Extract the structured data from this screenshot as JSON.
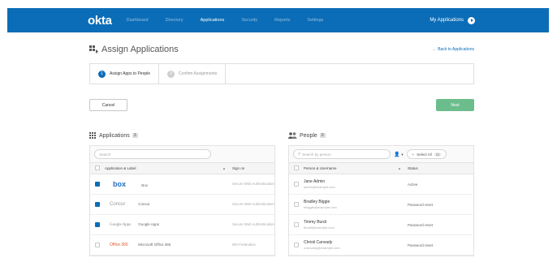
{
  "topbar": {
    "logo": "okta",
    "nav": [
      "Dashboard",
      "Directory",
      "Applications",
      "Security",
      "Reports",
      "Settings"
    ],
    "active_nav": "Applications",
    "my_apps": "My Applications",
    "color": "#0b6db7"
  },
  "header": {
    "title": "Assign Applications",
    "back_link": "← Back to Applications"
  },
  "steps": [
    {
      "num": "1",
      "label": "Assign Apps to People"
    },
    {
      "num": "2",
      "label": "Confirm Assignments"
    }
  ],
  "actions": {
    "cancel": "Cancel",
    "next": "Next",
    "next_color": "#6bbd8c"
  },
  "applications": {
    "title": "Applications",
    "count": "3",
    "search_placeholder": "Search",
    "columns": [
      "Application & Label",
      "Sign on"
    ],
    "rows": [
      {
        "logo": "box",
        "label": "Box",
        "signon": "Secure Web Authentication",
        "checked": true
      },
      {
        "logo": "Concur",
        "label": "Concur",
        "signon": "Secure Web Authentication",
        "checked": true
      },
      {
        "logo": "Google Apps",
        "label": "Google Apps",
        "signon": "Secure Web Authentication",
        "checked": true
      },
      {
        "logo": "Office 365",
        "label": "Microsoft Office 365",
        "signon": "WS-Federation",
        "checked": false
      }
    ]
  },
  "people": {
    "title": "People",
    "count": "0",
    "search_placeholder": "Search by person",
    "select_all": "Select All",
    "select_all_count": "21",
    "columns": [
      "Person & Username",
      "Status"
    ],
    "rows": [
      {
        "name": "Jane Admin",
        "email": "admin@example.com",
        "status": "Active"
      },
      {
        "name": "Bradley Biggie",
        "email": "bbiggie@example.com",
        "status": "Password reset"
      },
      {
        "name": "Timmy Burdi",
        "email": "tburdi@example.com",
        "status": "Password reset"
      },
      {
        "name": "Christi Canvady",
        "email": "ccanvady@example.com",
        "status": "Password reset"
      }
    ]
  }
}
